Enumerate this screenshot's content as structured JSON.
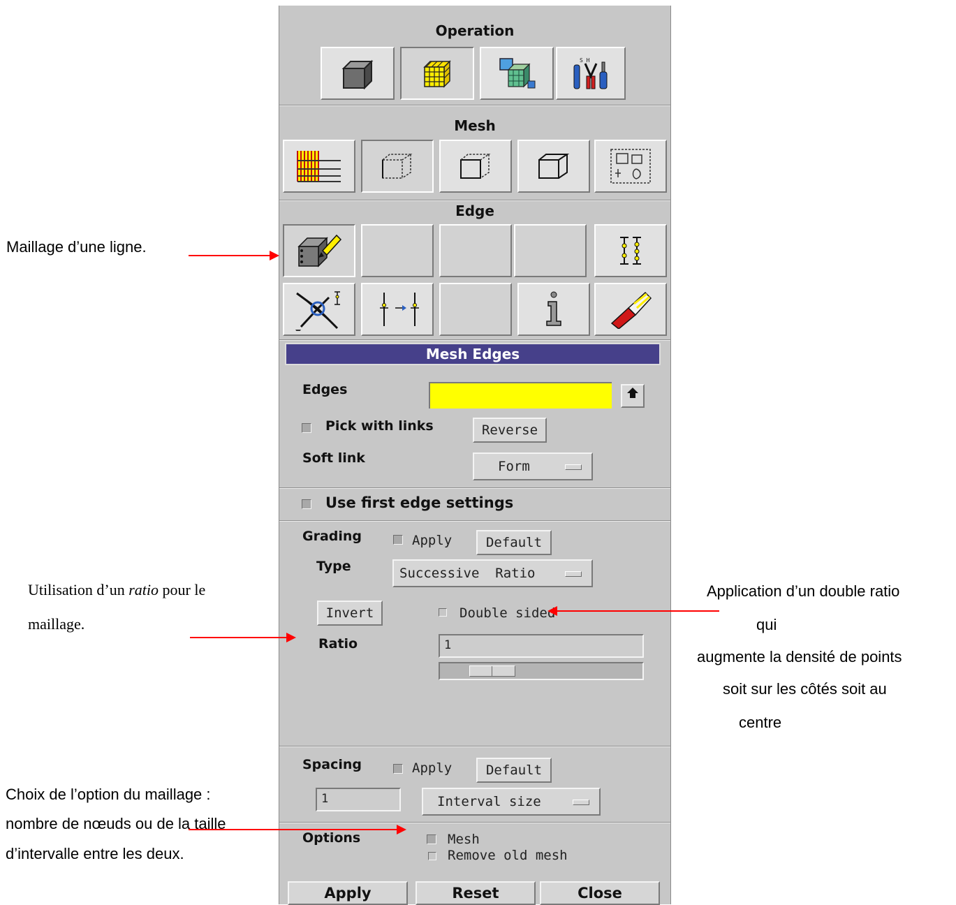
{
  "operation": {
    "title": "Operation",
    "icons": [
      "geometry-cube-icon",
      "mesh-grid-cube-icon",
      "zones-cube-icon",
      "tools-icon"
    ]
  },
  "mesh": {
    "title": "Mesh",
    "icons": [
      "boundary-layer-icon",
      "mesh-edges-icon",
      "mesh-faces-icon",
      "mesh-volumes-icon",
      "mesh-groups-icon"
    ]
  },
  "edge": {
    "title": "Edge",
    "row1_icons": [
      "mesh-edge-icon",
      "",
      "",
      "",
      "link-edges-icon"
    ],
    "row2_icons": [
      "modify-edge-icon",
      "split-edge-icon",
      "",
      "summarize-icon",
      "delete-edge-icon"
    ]
  },
  "form": {
    "title": "Mesh Edges",
    "edges_label": "Edges",
    "edges_value": "",
    "pick_with_links": "Pick with links",
    "reverse": "Reverse",
    "soft_link": "Soft link",
    "soft_link_value": "Form",
    "use_first": "Use first edge settings",
    "grading": "Grading",
    "grading_apply": "Apply",
    "grading_default": "Default",
    "type": "Type",
    "type_value": "Successive  Ratio",
    "invert": "Invert",
    "double_sided": "Double sided",
    "ratio": "Ratio",
    "ratio_value": "1",
    "spacing": "Spacing",
    "spacing_apply": "Apply",
    "spacing_default": "Default",
    "spacing_value": "1",
    "spacing_type": "Interval size",
    "options": "Options",
    "opt_mesh": "Mesh",
    "opt_remove": "Remove old mesh",
    "apply": "Apply",
    "reset": "Reset",
    "close": "Close"
  },
  "annotations": {
    "maillage_ligne": "Maillage d’une ligne.",
    "ratio_line1_pre": "Utilisation d’un ",
    "ratio_line1_em": "ratio",
    "ratio_line1_post": " pour le",
    "ratio_line2": "maillage.",
    "double_1": "Application d’un double ratio",
    "double_2": "qui",
    "double_3": "augmente la densité de points",
    "double_4": "soit sur les côtés soit au",
    "double_5": "centre",
    "choix_1": "Choix de l’option du maillage :",
    "choix_2": "nombre de nœuds ou de la taille",
    "choix_3": "d’intervalle entre les deux."
  }
}
